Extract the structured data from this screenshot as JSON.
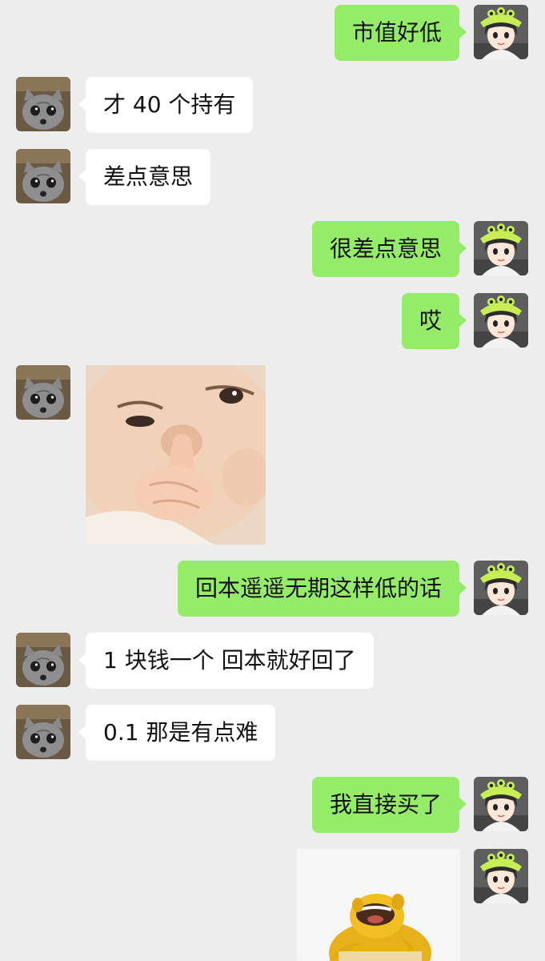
{
  "chat": {
    "messages": [
      {
        "id": "m1",
        "side": "right",
        "type": "text",
        "text": "市值好低"
      },
      {
        "id": "m2",
        "side": "left",
        "type": "text",
        "text": "才 40 个持有"
      },
      {
        "id": "m3",
        "side": "left",
        "type": "text",
        "text": "差点意思"
      },
      {
        "id": "m4",
        "side": "right",
        "type": "text",
        "text": "很差点意思"
      },
      {
        "id": "m5",
        "side": "right",
        "type": "text",
        "text": "哎"
      },
      {
        "id": "m6",
        "side": "left",
        "type": "sticker",
        "sticker": "baby-finger-in-nose-sticker"
      },
      {
        "id": "m7",
        "side": "right",
        "type": "text",
        "text": "回本遥遥无期这样低的话"
      },
      {
        "id": "m8",
        "side": "left",
        "type": "text",
        "text": "1 块钱一个 回本就好回了"
      },
      {
        "id": "m9",
        "side": "left",
        "type": "text",
        "text": "0.1 那是有点难"
      },
      {
        "id": "m10",
        "side": "right",
        "type": "text",
        "text": "我直接买了"
      },
      {
        "id": "m11",
        "side": "right",
        "type": "sticker",
        "sticker": "yellow-creature-laughing-sticker"
      }
    ]
  },
  "colors": {
    "background": "#ededed",
    "self_bubble": "#95ec69",
    "other_bubble": "#ffffff",
    "text": "#111111"
  },
  "avatars": {
    "self": "alien-hat-girl-avatar",
    "other": "surprised-cat-avatar"
  }
}
